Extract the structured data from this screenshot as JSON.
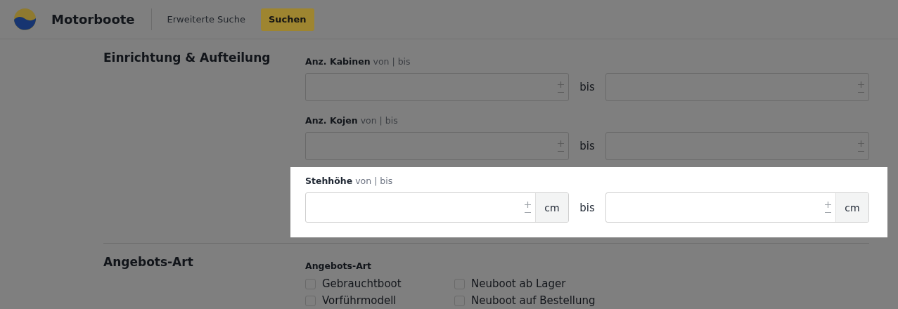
{
  "header": {
    "title": "Motorboote",
    "link": "Erweiterte Suche",
    "button": "Suchen"
  },
  "sections": [
    {
      "title": "Einrichtung & Aufteilung",
      "groups": [
        {
          "kind": "range",
          "label": "Anz. Kabinen",
          "hint": "von | bis",
          "separator": "bis",
          "highlighted": false
        },
        {
          "kind": "range",
          "label": "Anz. Kojen",
          "hint": "von | bis",
          "separator": "bis",
          "highlighted": false
        },
        {
          "kind": "range",
          "label": "Stehhöhe",
          "hint": "von | bis",
          "separator": "bis",
          "from_unit": "cm",
          "to_unit": "cm",
          "highlighted": true
        }
      ]
    },
    {
      "title": "Angebots-Art",
      "groups": [
        {
          "kind": "checkboxes",
          "label": "Angebots-Art",
          "options": [
            {
              "label": "Gebrauchtboot",
              "checked": false
            },
            {
              "label": "Neuboot ab Lager",
              "checked": false
            },
            {
              "label": "Vorführmodell",
              "checked": false
            },
            {
              "label": "Neuboot auf Bestellung",
              "checked": false
            }
          ]
        }
      ]
    }
  ]
}
